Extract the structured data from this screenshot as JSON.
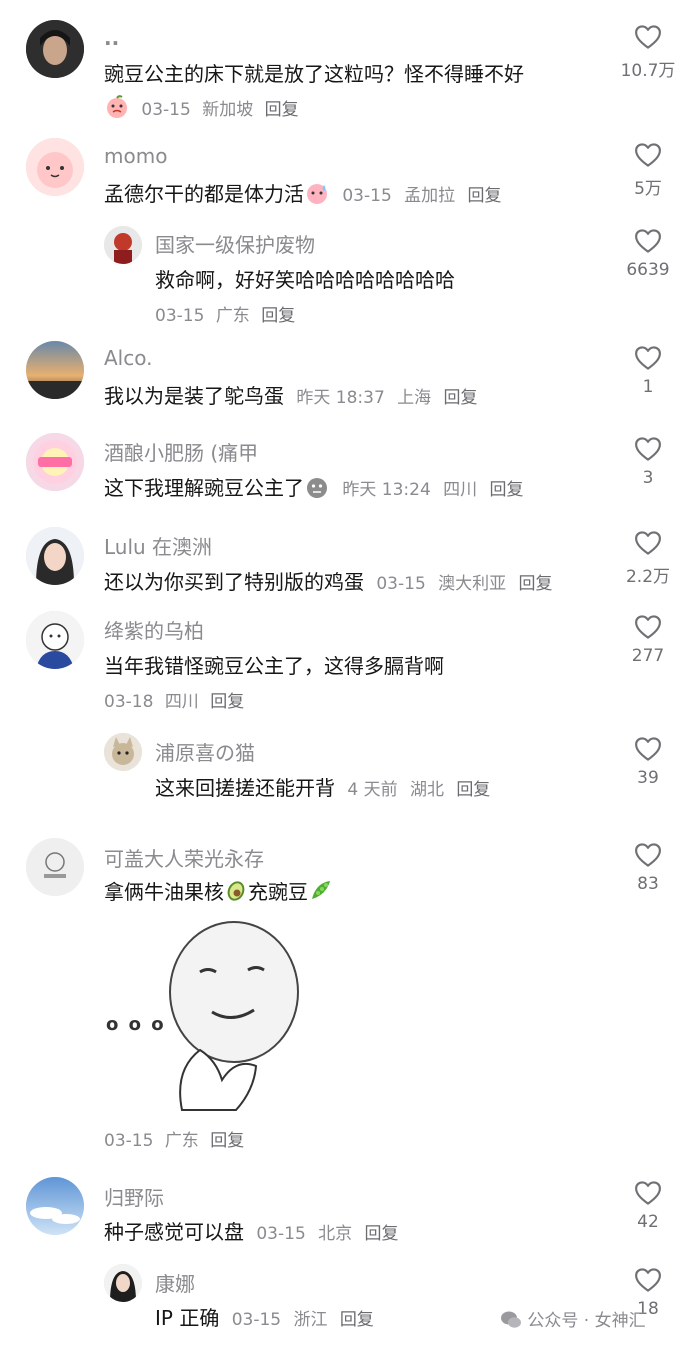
{
  "comments": [
    {
      "user": "..",
      "text": "豌豆公主的床下就是放了这粒吗？怪不得睡不好",
      "date": "03-15",
      "location": "新加坡",
      "reply": "回复",
      "likes": "10.7万"
    },
    {
      "user": "momo",
      "text": "孟德尔干的都是体力活",
      "date": "03-15",
      "location": "孟加拉",
      "reply": "回复",
      "likes": "5万"
    },
    {
      "user": "国家一级保护废物",
      "text": "救命啊，好好笑哈哈哈哈哈哈哈哈",
      "date": "03-15",
      "location": "广东",
      "reply": "回复",
      "likes": "6639"
    },
    {
      "user": "Alco.",
      "text": "我以为是装了鸵鸟蛋",
      "date": "昨天 18:37",
      "location": "上海",
      "reply": "回复",
      "likes": "1"
    },
    {
      "user": "酒酿小肥肠 (痛甲",
      "text": "这下我理解豌豆公主了",
      "date": "昨天 13:24",
      "location": "四川",
      "reply": "回复",
      "likes": "3"
    },
    {
      "user": "Lulu 在澳洲",
      "text": "还以为你买到了特别版的鸡蛋",
      "date": "03-15",
      "location": "澳大利亚",
      "reply": "回复",
      "likes": "2.2万"
    },
    {
      "user": "绛紫的乌柏",
      "text": "当年我错怪豌豆公主了，这得多膈背啊",
      "date": "03-18",
      "location": "四川",
      "reply": "回复",
      "likes": "277"
    },
    {
      "user": "浦原喜の猫",
      "text": "这来回搓搓还能开背",
      "date": "4 天前",
      "location": "湖北",
      "reply": "回复",
      "likes": "39"
    },
    {
      "user": "可盖大人荣光永存",
      "text_a": "拿俩牛油果核",
      "text_b": "充豌豆",
      "date": "03-15",
      "location": "广东",
      "reply": "回复",
      "likes": "83"
    },
    {
      "user": "归野际",
      "text": "种子感觉可以盘",
      "date": "03-15",
      "location": "北京",
      "reply": "回复",
      "likes": "42"
    },
    {
      "user": "康娜",
      "text": "IP 正确",
      "date": "03-15",
      "location": "浙江",
      "reply": "回复",
      "likes": "18"
    }
  ],
  "sticker": {
    "dots": "o o o"
  },
  "watermark": "公众号 · 女神汇",
  "colors": {
    "text": "#161616",
    "muted": "#8a8a8f",
    "background": "#ffffff"
  }
}
